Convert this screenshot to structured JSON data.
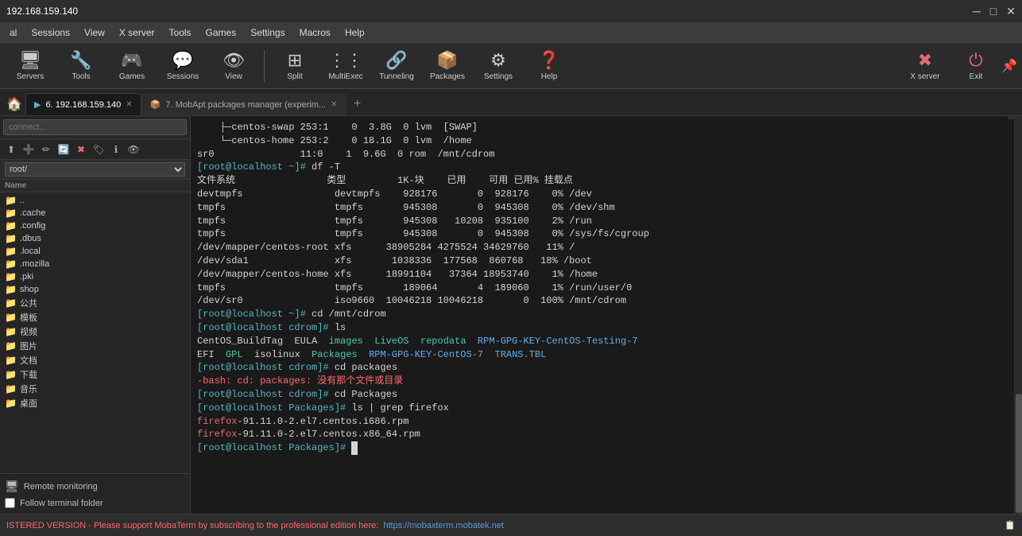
{
  "titlebar": {
    "title": "192.168.159.140",
    "minimize": "─",
    "maximize": "□",
    "close": "✕"
  },
  "menubar": {
    "items": [
      "al",
      "Sessions",
      "View",
      "X server",
      "Tools",
      "Games",
      "Settings",
      "Macros",
      "Help"
    ]
  },
  "toolbar": {
    "buttons": [
      {
        "id": "servers",
        "label": "Servers",
        "icon": "🖥"
      },
      {
        "id": "tools",
        "label": "Tools",
        "icon": "🔧"
      },
      {
        "id": "games",
        "label": "Games",
        "icon": "🎮"
      },
      {
        "id": "sessions",
        "label": "Sessions",
        "icon": "💬"
      },
      {
        "id": "view",
        "label": "View",
        "icon": "👁"
      },
      {
        "id": "split",
        "label": "Split",
        "icon": "⊞"
      },
      {
        "id": "multiexec",
        "label": "MultiExec",
        "icon": "⋮"
      },
      {
        "id": "tunneling",
        "label": "Tunneling",
        "icon": "🔗"
      },
      {
        "id": "packages",
        "label": "Packages",
        "icon": "📦"
      },
      {
        "id": "settings",
        "label": "Settings",
        "icon": "⚙"
      },
      {
        "id": "help",
        "label": "Help",
        "icon": "❓"
      }
    ],
    "right_buttons": [
      {
        "id": "xserver",
        "label": "X server",
        "icon": "✖"
      },
      {
        "id": "exit",
        "label": "Exit",
        "icon": "⏻"
      }
    ]
  },
  "tabs": {
    "items": [
      {
        "id": "tab1",
        "label": "6. 192.168.159.140",
        "active": true
      },
      {
        "id": "tab2",
        "label": "7. MobApt packages manager (experim...",
        "active": false
      }
    ]
  },
  "sidebar": {
    "search_placeholder": "connect...",
    "path_select": "root/",
    "col_header": "Name",
    "files": [
      {
        "name": "..",
        "icon": "📁"
      },
      {
        "name": ".cache",
        "icon": "📁"
      },
      {
        "name": ".config",
        "icon": "📁"
      },
      {
        "name": ".dbus",
        "icon": "📁"
      },
      {
        "name": ".local",
        "icon": "📁"
      },
      {
        "name": ".mozilla",
        "icon": "📁"
      },
      {
        "name": ".pki",
        "icon": "📁"
      },
      {
        "name": "shop",
        "icon": "📁"
      },
      {
        "name": "公共",
        "icon": "📁"
      },
      {
        "name": "模板",
        "icon": "📁"
      },
      {
        "name": "视频",
        "icon": "📁"
      },
      {
        "name": "图片",
        "icon": "📁"
      },
      {
        "name": "文档",
        "icon": "📁"
      },
      {
        "name": "下载",
        "icon": "📁"
      },
      {
        "name": "音乐",
        "icon": "📁"
      },
      {
        "name": "桌面",
        "icon": "📁"
      }
    ],
    "bottom": {
      "remote_monitoring_label": "Remote monitoring",
      "follow_terminal_label": "Follow terminal folder"
    }
  },
  "terminal": {
    "lines": [
      {
        "type": "normal",
        "content": "    ├─centos-swap 253:1    0  3.8G  0 lvm  [SWAP]"
      },
      {
        "type": "normal",
        "content": "    └─centos-home 253:2    0 18.1G  0 lvm  /home"
      },
      {
        "type": "normal",
        "content": "sr0               11:0    1  9.6G  0 rom  /mnt/cdrom"
      },
      {
        "type": "prompt",
        "content": "[root@localhost ~]# df -T"
      },
      {
        "type": "header",
        "content": "文件系统                类型         1K-块    已用    可用 已用% 挂载点"
      },
      {
        "type": "normal",
        "content": "devtmpfs                devtmpfs    928176       0  928176    0% /dev"
      },
      {
        "type": "normal",
        "content": "tmpfs                   tmpfs       945308       0  945308    0% /dev/shm"
      },
      {
        "type": "normal",
        "content": "tmpfs                   tmpfs       945308   10208  935100    2% /run"
      },
      {
        "type": "normal",
        "content": "tmpfs                   tmpfs       945308       0  945308    0% /sys/fs/cgroup"
      },
      {
        "type": "normal",
        "content": "/dev/mapper/centos-root xfs      38905284 4275524 34629760   11% /"
      },
      {
        "type": "normal",
        "content": "/dev/sda1               xfs       1038336  177568  860768   18% /boot"
      },
      {
        "type": "normal",
        "content": "/dev/mapper/centos-home xfs      18991104   37364 18953740    1% /home"
      },
      {
        "type": "normal",
        "content": "tmpfs                   tmpfs       189064       4  189060    1% /run/user/0"
      },
      {
        "type": "normal",
        "content": "/dev/sr0                iso9660  10046218 10046218       0  100% /mnt/cdrom"
      },
      {
        "type": "prompt",
        "content": "[root@localhost ~]# cd /mnt/cdrom"
      },
      {
        "type": "prompt",
        "content": "[root@localhost cdrom]# ls"
      },
      {
        "type": "ls_output",
        "content": "CentOS_BuildTag  EULA  images  LiveOS  repodata                RPM-GPG-KEY-CentOS-Testing-7"
      },
      {
        "type": "ls_output2",
        "content": "EFI              GPL   isolinux  Packages  RPM-GPG-KEY-CentOS-7  TRANS.TBL"
      },
      {
        "type": "prompt",
        "content": "[root@localhost cdrom]# cd packages"
      },
      {
        "type": "error",
        "content": "-bash: cd: packages: 没有那个文件或目录"
      },
      {
        "type": "prompt",
        "content": "[root@localhost cdrom]# cd Packages"
      },
      {
        "type": "prompt",
        "content": "[root@localhost Packages]# ls | grep firefox"
      },
      {
        "type": "firefox1",
        "content": "firefox-91.11.0-2.el7.centos.i686.rpm"
      },
      {
        "type": "firefox2",
        "content": "firefox-91.11.0-2.el7.centos.x86_64.rpm"
      },
      {
        "type": "input",
        "content": "[root@localhost Packages]# "
      }
    ]
  },
  "statusbar": {
    "text": "ISTERED VERSION  -  Please support MobaTerm by subscribing to the professional edition here:",
    "link_text": "https://mobaxterm.mobatek.net"
  }
}
